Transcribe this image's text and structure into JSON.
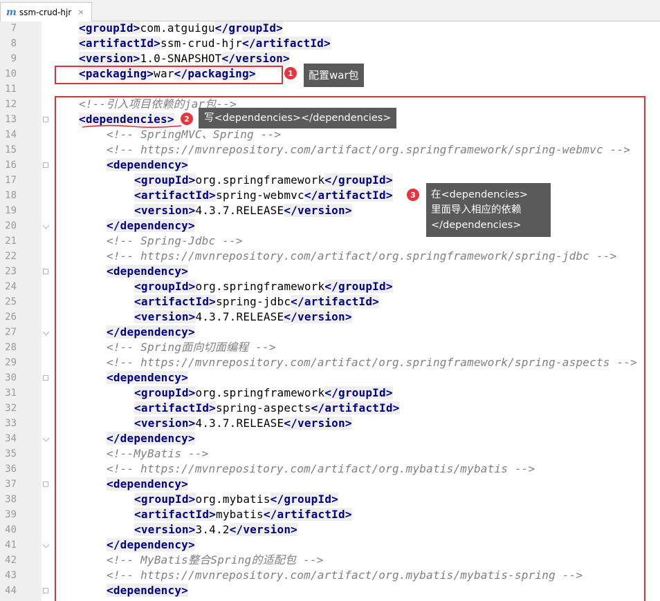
{
  "tab": {
    "icon": "maven-m-icon",
    "icon_glyph": "m",
    "title": "ssm-crud-hjr",
    "close": "×"
  },
  "lines": [
    {
      "n": "7",
      "indent": 1,
      "segs": [
        [
          "tg",
          "<groupId>"
        ],
        [
          "tx",
          "com.atguigu"
        ],
        [
          "tg",
          "</groupId>"
        ]
      ]
    },
    {
      "n": "8",
      "indent": 1,
      "segs": [
        [
          "tg",
          "<artifactId>"
        ],
        [
          "tx",
          "ssm-crud-hjr"
        ],
        [
          "tg",
          "</artifactId>"
        ]
      ]
    },
    {
      "n": "9",
      "indent": 1,
      "segs": [
        [
          "tg",
          "<version>"
        ],
        [
          "tx",
          "1.0-SNAPSHOT"
        ],
        [
          "tg",
          "</version>"
        ]
      ]
    },
    {
      "n": "10",
      "indent": 1,
      "segs": [
        [
          "tg",
          "<packaging>"
        ],
        [
          "tx",
          "war"
        ],
        [
          "tg",
          "</packaging>"
        ]
      ]
    },
    {
      "n": "11",
      "indent": 0,
      "segs": []
    },
    {
      "n": "12",
      "indent": 1,
      "segs": [
        [
          "cm",
          "<!--引入项目依赖的jar包-->"
        ]
      ]
    },
    {
      "n": "13",
      "indent": 1,
      "fold": "open",
      "segs": [
        [
          "tg",
          "<dependencies>"
        ]
      ]
    },
    {
      "n": "14",
      "indent": 2,
      "segs": [
        [
          "cm",
          "<!-- SpringMVC、Spring -->"
        ]
      ]
    },
    {
      "n": "15",
      "indent": 2,
      "segs": [
        [
          "cm",
          "<!-- https://mvnrepository.com/artifact/org.springframework/spring-webmvc -->"
        ]
      ]
    },
    {
      "n": "16",
      "indent": 2,
      "fold": "open",
      "segs": [
        [
          "tg",
          "<dependency>"
        ]
      ]
    },
    {
      "n": "17",
      "indent": 3,
      "segs": [
        [
          "tg",
          "<groupId>"
        ],
        [
          "tx",
          "org.springframework"
        ],
        [
          "tg",
          "</groupId>"
        ]
      ]
    },
    {
      "n": "18",
      "indent": 3,
      "segs": [
        [
          "tg",
          "<artifactId>"
        ],
        [
          "tx",
          "spring-webmvc"
        ],
        [
          "tg",
          "</artifactId>"
        ]
      ]
    },
    {
      "n": "19",
      "indent": 3,
      "segs": [
        [
          "tg",
          "<version>"
        ],
        [
          "tx",
          "4.3.7.RELEASE"
        ],
        [
          "tg",
          "</version>"
        ]
      ]
    },
    {
      "n": "20",
      "indent": 2,
      "fold": "end",
      "segs": [
        [
          "tg",
          "</dependency>"
        ]
      ]
    },
    {
      "n": "21",
      "indent": 2,
      "segs": [
        [
          "cm",
          "<!-- Spring-Jdbc -->"
        ]
      ]
    },
    {
      "n": "22",
      "indent": 2,
      "segs": [
        [
          "cm",
          "<!-- https://mvnrepository.com/artifact/org.springframework/spring-jdbc -->"
        ]
      ]
    },
    {
      "n": "23",
      "indent": 2,
      "fold": "open",
      "segs": [
        [
          "tg",
          "<dependency>"
        ]
      ]
    },
    {
      "n": "24",
      "indent": 3,
      "segs": [
        [
          "tg",
          "<groupId>"
        ],
        [
          "tx",
          "org.springframework"
        ],
        [
          "tg",
          "</groupId>"
        ]
      ]
    },
    {
      "n": "25",
      "indent": 3,
      "segs": [
        [
          "tg",
          "<artifactId>"
        ],
        [
          "tx",
          "spring-jdbc"
        ],
        [
          "tg",
          "</artifactId>"
        ]
      ]
    },
    {
      "n": "26",
      "indent": 3,
      "segs": [
        [
          "tg",
          "<version>"
        ],
        [
          "tx",
          "4.3.7.RELEASE"
        ],
        [
          "tg",
          "</version>"
        ]
      ]
    },
    {
      "n": "27",
      "indent": 2,
      "fold": "end",
      "segs": [
        [
          "tg",
          "</dependency>"
        ]
      ]
    },
    {
      "n": "28",
      "indent": 2,
      "segs": [
        [
          "cm",
          "<!-- Spring面向切面编程 -->"
        ]
      ]
    },
    {
      "n": "29",
      "indent": 2,
      "segs": [
        [
          "cm",
          "<!-- https://mvnrepository.com/artifact/org.springframework/spring-aspects -->"
        ]
      ]
    },
    {
      "n": "30",
      "indent": 2,
      "fold": "open",
      "segs": [
        [
          "tg",
          "<dependency>"
        ]
      ]
    },
    {
      "n": "31",
      "indent": 3,
      "segs": [
        [
          "tg",
          "<groupId>"
        ],
        [
          "tx",
          "org.springframework"
        ],
        [
          "tg",
          "</groupId>"
        ]
      ]
    },
    {
      "n": "32",
      "indent": 3,
      "segs": [
        [
          "tg",
          "<artifactId>"
        ],
        [
          "tx",
          "spring-aspects"
        ],
        [
          "tg",
          "</artifactId>"
        ]
      ]
    },
    {
      "n": "33",
      "indent": 3,
      "segs": [
        [
          "tg",
          "<version>"
        ],
        [
          "tx",
          "4.3.7.RELEASE"
        ],
        [
          "tg",
          "</version>"
        ]
      ]
    },
    {
      "n": "34",
      "indent": 2,
      "fold": "end",
      "segs": [
        [
          "tg",
          "</dependency>"
        ]
      ]
    },
    {
      "n": "35",
      "indent": 2,
      "segs": [
        [
          "cm",
          "<!--MyBatis -->"
        ]
      ]
    },
    {
      "n": "36",
      "indent": 2,
      "segs": [
        [
          "cm",
          "<!-- https://mvnrepository.com/artifact/org.mybatis/mybatis -->"
        ]
      ]
    },
    {
      "n": "37",
      "indent": 2,
      "fold": "open",
      "segs": [
        [
          "tg",
          "<dependency>"
        ]
      ]
    },
    {
      "n": "38",
      "indent": 3,
      "segs": [
        [
          "tg",
          "<groupId>"
        ],
        [
          "tx",
          "org.mybatis"
        ],
        [
          "tg",
          "</groupId>"
        ]
      ]
    },
    {
      "n": "39",
      "indent": 3,
      "segs": [
        [
          "tg",
          "<artifactId>"
        ],
        [
          "tx",
          "mybatis"
        ],
        [
          "tg",
          "</artifactId>"
        ]
      ]
    },
    {
      "n": "40",
      "indent": 3,
      "segs": [
        [
          "tg",
          "<version>"
        ],
        [
          "tx",
          "3.4.2"
        ],
        [
          "tg",
          "</version>"
        ]
      ]
    },
    {
      "n": "41",
      "indent": 2,
      "fold": "end",
      "segs": [
        [
          "tg",
          "</dependency>"
        ]
      ]
    },
    {
      "n": "42",
      "indent": 2,
      "segs": [
        [
          "cm",
          "<!-- MyBatis整合Spring的适配包 -->"
        ]
      ]
    },
    {
      "n": "43",
      "indent": 2,
      "segs": [
        [
          "cm",
          "<!-- https://mvnrepository.com/artifact/org.mybatis/mybatis-spring -->"
        ]
      ]
    },
    {
      "n": "44",
      "indent": 2,
      "fold": "open",
      "segs": [
        [
          "tg",
          "<dependency>"
        ]
      ]
    }
  ],
  "annotations": {
    "a1": {
      "num": "1",
      "text": "配置war包"
    },
    "a2": {
      "num": "2",
      "text": "写<dependencies></dependencies>"
    },
    "a3": {
      "num": "3",
      "text": "在<dependencies>\n里面导入相应的依赖\n</dependencies>"
    }
  },
  "colors": {
    "tag": "#000080",
    "comment": "#808080",
    "highlight_box": "#e0313a",
    "badge": "#e8343d",
    "note_bg": "#5a5a5a"
  }
}
